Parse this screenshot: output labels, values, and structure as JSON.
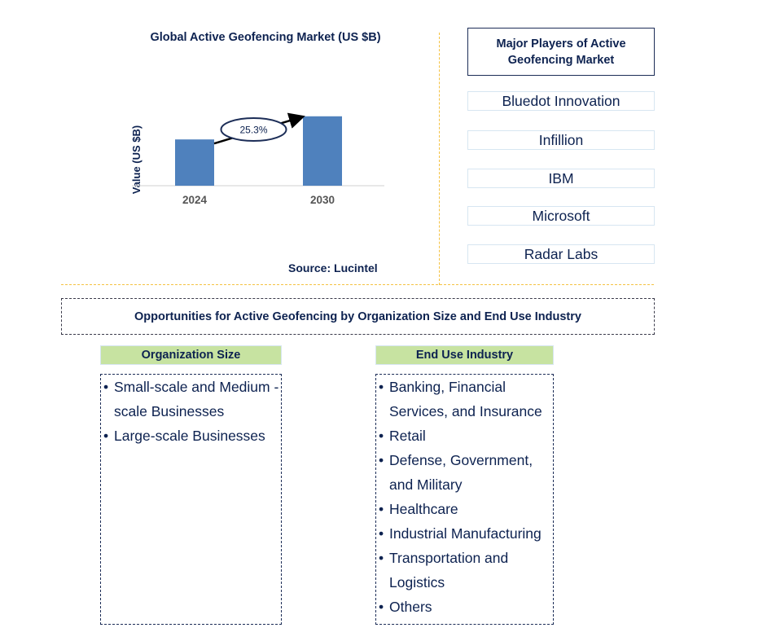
{
  "chart_data": {
    "type": "bar",
    "title": "Global Active Geofencing Market (US $B)",
    "xlabel": "",
    "ylabel": "Value (US $B)",
    "categories": [
      "2024",
      "2030"
    ],
    "values": [
      1.0,
      1.5
    ],
    "value_units": "relative (no axis ticks shown)",
    "annotation": {
      "text": "25.3%",
      "meaning": "CAGR 2024-2030",
      "style": "ellipse with arrow"
    },
    "grid": false,
    "bar_color": "#4f81bd",
    "source": "Source: Lucintel"
  },
  "players": {
    "title": "Major Players of Active Geofencing Market",
    "items": [
      "Bluedot Innovation",
      "Infillion",
      "IBM",
      "Microsoft",
      "Radar Labs"
    ]
  },
  "opportunities": {
    "title": "Opportunities for Active Geofencing by Organization Size and End Use Industry",
    "categories": [
      {
        "header": "Organization Size",
        "items": [
          "Small-scale and Medium -scale Businesses",
          "Large-scale Businesses"
        ]
      },
      {
        "header": "End Use Industry",
        "items": [
          "Banking, Financial Services, and Insurance",
          "Retail",
          "Defense, Government, and Military",
          "Healthcare",
          "Industrial Manufacturing",
          "Transportation and Logistics",
          "Others"
        ]
      }
    ]
  },
  "colors": {
    "text": "#0d2250",
    "bar": "#4f81bd",
    "header_fill": "#c7e3a1",
    "divider": "#f5c242"
  }
}
